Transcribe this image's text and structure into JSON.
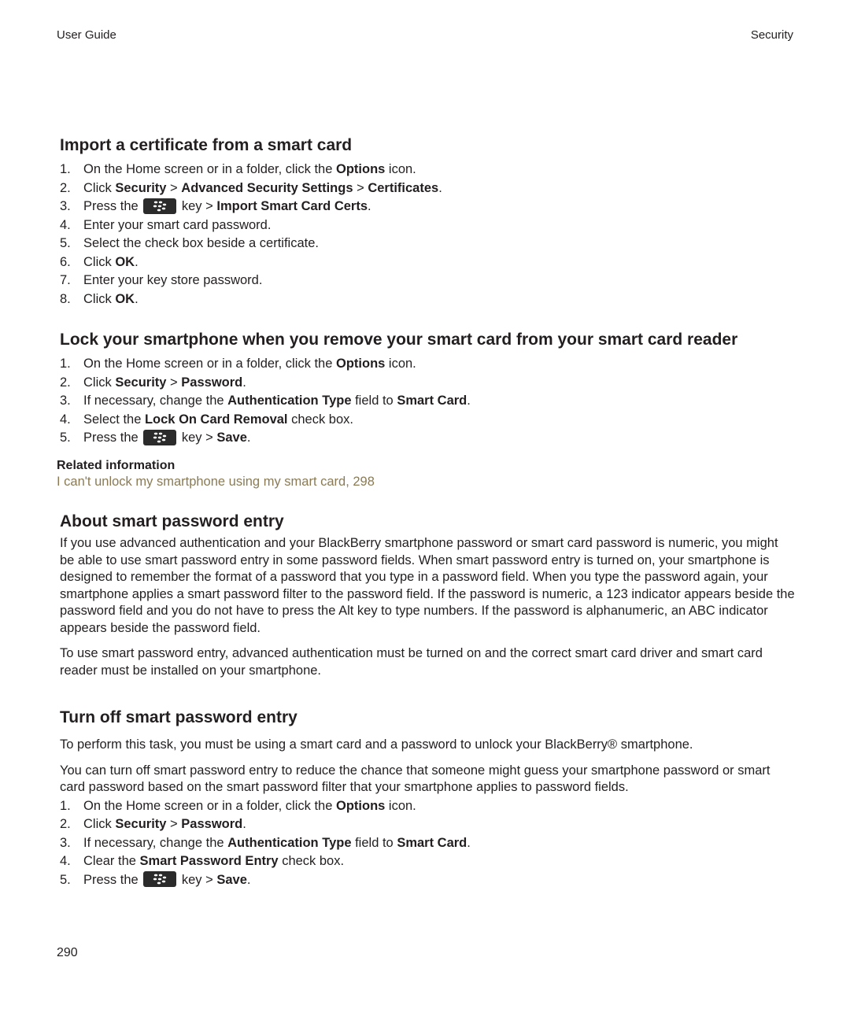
{
  "header": {
    "left": "User Guide",
    "right": "Security"
  },
  "sections": [
    {
      "title": "Import a certificate from a smart card",
      "steps": [
        {
          "n": "1.",
          "parts": [
            {
              "t": "On the Home screen or in a folder, click the "
            },
            {
              "b": "Options"
            },
            {
              "t": " icon."
            }
          ]
        },
        {
          "n": "2.",
          "parts": [
            {
              "t": "Click "
            },
            {
              "b": "Security"
            },
            {
              "t": " > "
            },
            {
              "b": "Advanced Security Settings"
            },
            {
              "t": " > "
            },
            {
              "b": "Certificates"
            },
            {
              "t": "."
            }
          ]
        },
        {
          "n": "3.",
          "parts": [
            {
              "t": "Press the "
            },
            {
              "key": "blackberry-menu-key"
            },
            {
              "t": " key > "
            },
            {
              "b": "Import Smart Card Certs"
            },
            {
              "t": "."
            }
          ]
        },
        {
          "n": "4.",
          "parts": [
            {
              "t": "Enter your smart card password."
            }
          ]
        },
        {
          "n": "5.",
          "parts": [
            {
              "t": "Select the check box beside a certificate."
            }
          ]
        },
        {
          "n": "6.",
          "parts": [
            {
              "t": "Click "
            },
            {
              "b": "OK"
            },
            {
              "t": "."
            }
          ]
        },
        {
          "n": "7.",
          "parts": [
            {
              "t": "Enter your key store password."
            }
          ]
        },
        {
          "n": "8.",
          "parts": [
            {
              "t": "Click "
            },
            {
              "b": "OK"
            },
            {
              "t": "."
            }
          ]
        }
      ]
    },
    {
      "title": "Lock your smartphone when you remove your smart card from your smart card reader",
      "steps": [
        {
          "n": "1.",
          "parts": [
            {
              "t": "On the Home screen or in a folder, click the "
            },
            {
              "b": "Options"
            },
            {
              "t": " icon."
            }
          ]
        },
        {
          "n": "2.",
          "parts": [
            {
              "t": "Click "
            },
            {
              "b": "Security"
            },
            {
              "t": " > "
            },
            {
              "b": "Password"
            },
            {
              "t": "."
            }
          ]
        },
        {
          "n": "3.",
          "parts": [
            {
              "t": "If necessary, change the "
            },
            {
              "b": "Authentication Type"
            },
            {
              "t": " field to "
            },
            {
              "b": "Smart Card"
            },
            {
              "t": "."
            }
          ]
        },
        {
          "n": "4.",
          "parts": [
            {
              "t": "Select the "
            },
            {
              "b": "Lock On Card Removal"
            },
            {
              "t": " check box."
            }
          ]
        },
        {
          "n": "5.",
          "parts": [
            {
              "t": "Press the "
            },
            {
              "key": "blackberry-menu-key"
            },
            {
              "t": " key > "
            },
            {
              "b": "Save"
            },
            {
              "t": "."
            }
          ]
        }
      ],
      "related": {
        "title": "Related information",
        "link": "I can't unlock my smartphone using my smart card, 298"
      }
    },
    {
      "title": "About smart password entry",
      "paragraphs": [
        "If you use advanced authentication and your BlackBerry smartphone password or smart card password is numeric, you might be able to use smart password entry in some password fields. When smart password entry is turned on, your smartphone is designed to remember the format of a password that you type in a password field. When you type the password again, your smartphone applies a smart password filter to the password field. If the password is numeric, a 123 indicator appears beside the password field and you do not have to press the Alt key to type numbers. If the password is alphanumeric, an ABC indicator appears beside the password field.",
        "To use smart password entry, advanced authentication must be turned on and the correct smart card driver and smart card reader must be installed on your smartphone."
      ]
    },
    {
      "title": "Turn off smart password entry",
      "paragraphs": [
        "To perform this task, you must be using a smart card and a password to unlock your BlackBerry® smartphone.",
        "You can turn off smart password entry to reduce the chance that someone might guess your smartphone password or smart card password based on the smart password filter that your smartphone applies to password fields."
      ],
      "steps": [
        {
          "n": "1.",
          "parts": [
            {
              "t": "On the Home screen or in a folder, click the "
            },
            {
              "b": "Options"
            },
            {
              "t": " icon."
            }
          ]
        },
        {
          "n": "2.",
          "parts": [
            {
              "t": "Click "
            },
            {
              "b": "Security"
            },
            {
              "t": " > "
            },
            {
              "b": "Password"
            },
            {
              "t": "."
            }
          ]
        },
        {
          "n": "3.",
          "parts": [
            {
              "t": "If necessary, change the "
            },
            {
              "b": "Authentication Type"
            },
            {
              "t": " field to "
            },
            {
              "b": "Smart Card"
            },
            {
              "t": "."
            }
          ]
        },
        {
          "n": "4.",
          "parts": [
            {
              "t": "Clear the "
            },
            {
              "b": "Smart Password Entry"
            },
            {
              "t": " check box."
            }
          ]
        },
        {
          "n": "5.",
          "parts": [
            {
              "t": "Press the "
            },
            {
              "key": "blackberry-menu-key"
            },
            {
              "t": " key > "
            },
            {
              "b": "Save"
            },
            {
              "t": "."
            }
          ]
        }
      ]
    }
  ],
  "footer": {
    "page_number": "290"
  }
}
